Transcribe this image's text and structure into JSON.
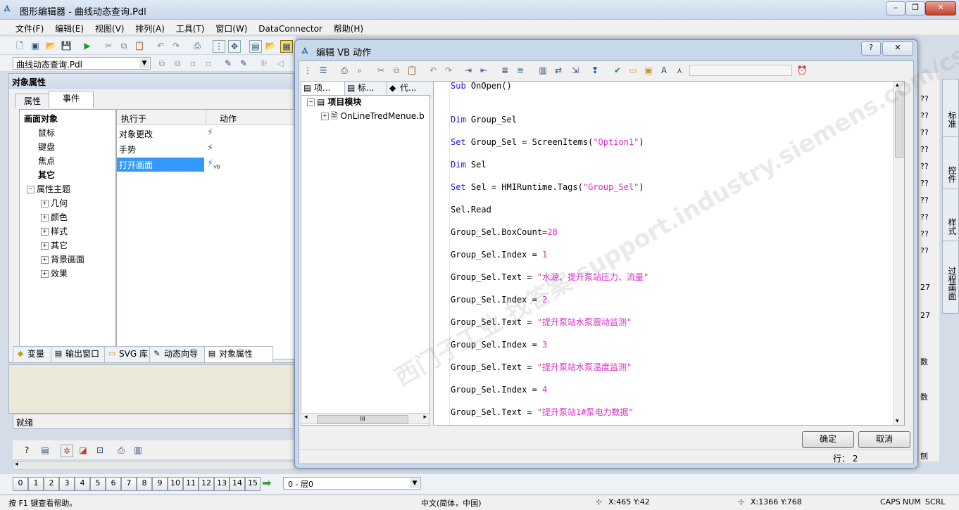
{
  "main_window": {
    "title": "图形编辑器 - 曲线动态查询.Pdl",
    "minimize": "–",
    "restore": "❐",
    "close": "✕"
  },
  "menu": [
    "文件(F)",
    "编辑(E)",
    "视图(V)",
    "排列(A)",
    "工具(T)",
    "窗口(W)",
    "DataConnector",
    "帮助(H)"
  ],
  "object_combo": "曲线动态查询.Pdl",
  "properties_panel": {
    "title": "对象属性",
    "tabs": [
      "属性",
      "事件"
    ],
    "tree": [
      {
        "label": "画面对象",
        "bold": true,
        "level": 0
      },
      {
        "label": "鼠标",
        "level": 1
      },
      {
        "label": "键盘",
        "level": 1
      },
      {
        "label": "焦点",
        "level": 1
      },
      {
        "label": "其它",
        "bold": true,
        "level": 1
      },
      {
        "label": "属性主题",
        "level": 1,
        "expander": "−"
      },
      {
        "label": "几何",
        "level": 2,
        "expander": "+"
      },
      {
        "label": "颜色",
        "level": 2,
        "expander": "+"
      },
      {
        "label": "样式",
        "level": 2,
        "expander": "+"
      },
      {
        "label": "其它",
        "level": 2,
        "expander": "+"
      },
      {
        "label": "背景画面",
        "level": 2,
        "expander": "+"
      },
      {
        "label": "效果",
        "level": 2,
        "expander": "+"
      }
    ],
    "grid_headers": [
      "执行于",
      "动作"
    ],
    "grid_rows": [
      {
        "label": "对象更改",
        "selected": false,
        "vb": ""
      },
      {
        "label": "手势",
        "selected": false,
        "vb": ""
      },
      {
        "label": "打开画面",
        "selected": true,
        "vb": "VB"
      }
    ]
  },
  "bottom_tabs": [
    "变量",
    "输出窗口",
    "SVG 库",
    "动态向导",
    "对象属性"
  ],
  "output_status": "就绪",
  "layers": [
    "0",
    "1",
    "2",
    "3",
    "4",
    "5",
    "6",
    "7",
    "8",
    "9",
    "10",
    "11",
    "12",
    "13",
    "14",
    "15"
  ],
  "layer_combo": "0 - 层0",
  "side_tabs": [
    "标准",
    "控件",
    "样式",
    "过程画面"
  ],
  "right_edge_labels": [
    "??",
    "??",
    "??",
    "??",
    "??",
    "??",
    "??",
    "??",
    "??",
    "??",
    "27",
    "27",
    "数",
    "数",
    "刨"
  ],
  "status_bar": {
    "help": "按 F1 键查看帮助。",
    "lang": "中文(简体，中国)",
    "pos": "X:465 Y:42",
    "size": "X:1366 Y:768",
    "caps": "CAPS",
    "num": "NUM",
    "scrl": "SCRL"
  },
  "dialog": {
    "title": "编辑 VB 动作",
    "help_btn": "?",
    "close_btn": "✕",
    "tabs": [
      "项...",
      "标...",
      "代..."
    ],
    "tree_root": "项目模块",
    "tree_child": "OnLineTredMenue.b",
    "hscroll_label": "III",
    "code": [
      [
        {
          "t": "Sub",
          "c": "kw"
        },
        {
          "t": " OnOpen()",
          "c": ""
        }
      ],
      [],
      [
        {
          "t": "Dim",
          "c": "kw"
        },
        {
          "t": " Group_Sel",
          "c": ""
        }
      ],
      [
        {
          "t": "Set",
          "c": "kw"
        },
        {
          "t": " Group_Sel = ScreenItems(",
          "c": ""
        },
        {
          "t": "\"Option1\"",
          "c": "str"
        },
        {
          "t": ")",
          "c": ""
        }
      ],
      [
        {
          "t": "Dim",
          "c": "kw"
        },
        {
          "t": " Sel",
          "c": ""
        }
      ],
      [
        {
          "t": "Set",
          "c": "kw"
        },
        {
          "t": " Sel = HMIRuntime.Tags(",
          "c": ""
        },
        {
          "t": "\"Group_Sel\"",
          "c": "str"
        },
        {
          "t": ")",
          "c": ""
        }
      ],
      [
        {
          "t": "Sel.Read",
          "c": ""
        }
      ],
      [
        {
          "t": "Group_Sel.BoxCount=",
          "c": ""
        },
        {
          "t": "28",
          "c": "num"
        }
      ],
      [
        {
          "t": "Group_Sel.Index = ",
          "c": ""
        },
        {
          "t": "1",
          "c": "num"
        }
      ],
      [
        {
          "t": "Group_Sel.Text = ",
          "c": ""
        },
        {
          "t": "\"水源、提升泵站压力、流量\"",
          "c": "str"
        }
      ],
      [
        {
          "t": "Group_Sel.Index = ",
          "c": ""
        },
        {
          "t": "2",
          "c": "num"
        }
      ],
      [
        {
          "t": "Group_Sel.Text = ",
          "c": ""
        },
        {
          "t": "\"提升泵站水泵震动监测\"",
          "c": "str"
        }
      ],
      [
        {
          "t": "Group_Sel.Index = ",
          "c": ""
        },
        {
          "t": "3",
          "c": "num"
        }
      ],
      [
        {
          "t": "Group_Sel.Text = ",
          "c": ""
        },
        {
          "t": "\"提升泵站水泵温度监测\"",
          "c": "str"
        }
      ],
      [
        {
          "t": "Group_Sel.Index = ",
          "c": ""
        },
        {
          "t": "4",
          "c": "num"
        }
      ],
      [
        {
          "t": "Group_Sel.Text = ",
          "c": ""
        },
        {
          "t": "\"提升泵站1#泵电力数据\"",
          "c": "str"
        }
      ]
    ],
    "ok": "确定",
    "cancel": "取消",
    "row_status": "行： 2"
  },
  "watermark": "西门子工业 找答案 support.industry.siemens.com/cs",
  "colors": {
    "keyword": "#1b1bd9",
    "string": "#d92cc8",
    "selection": "#3399ff"
  }
}
